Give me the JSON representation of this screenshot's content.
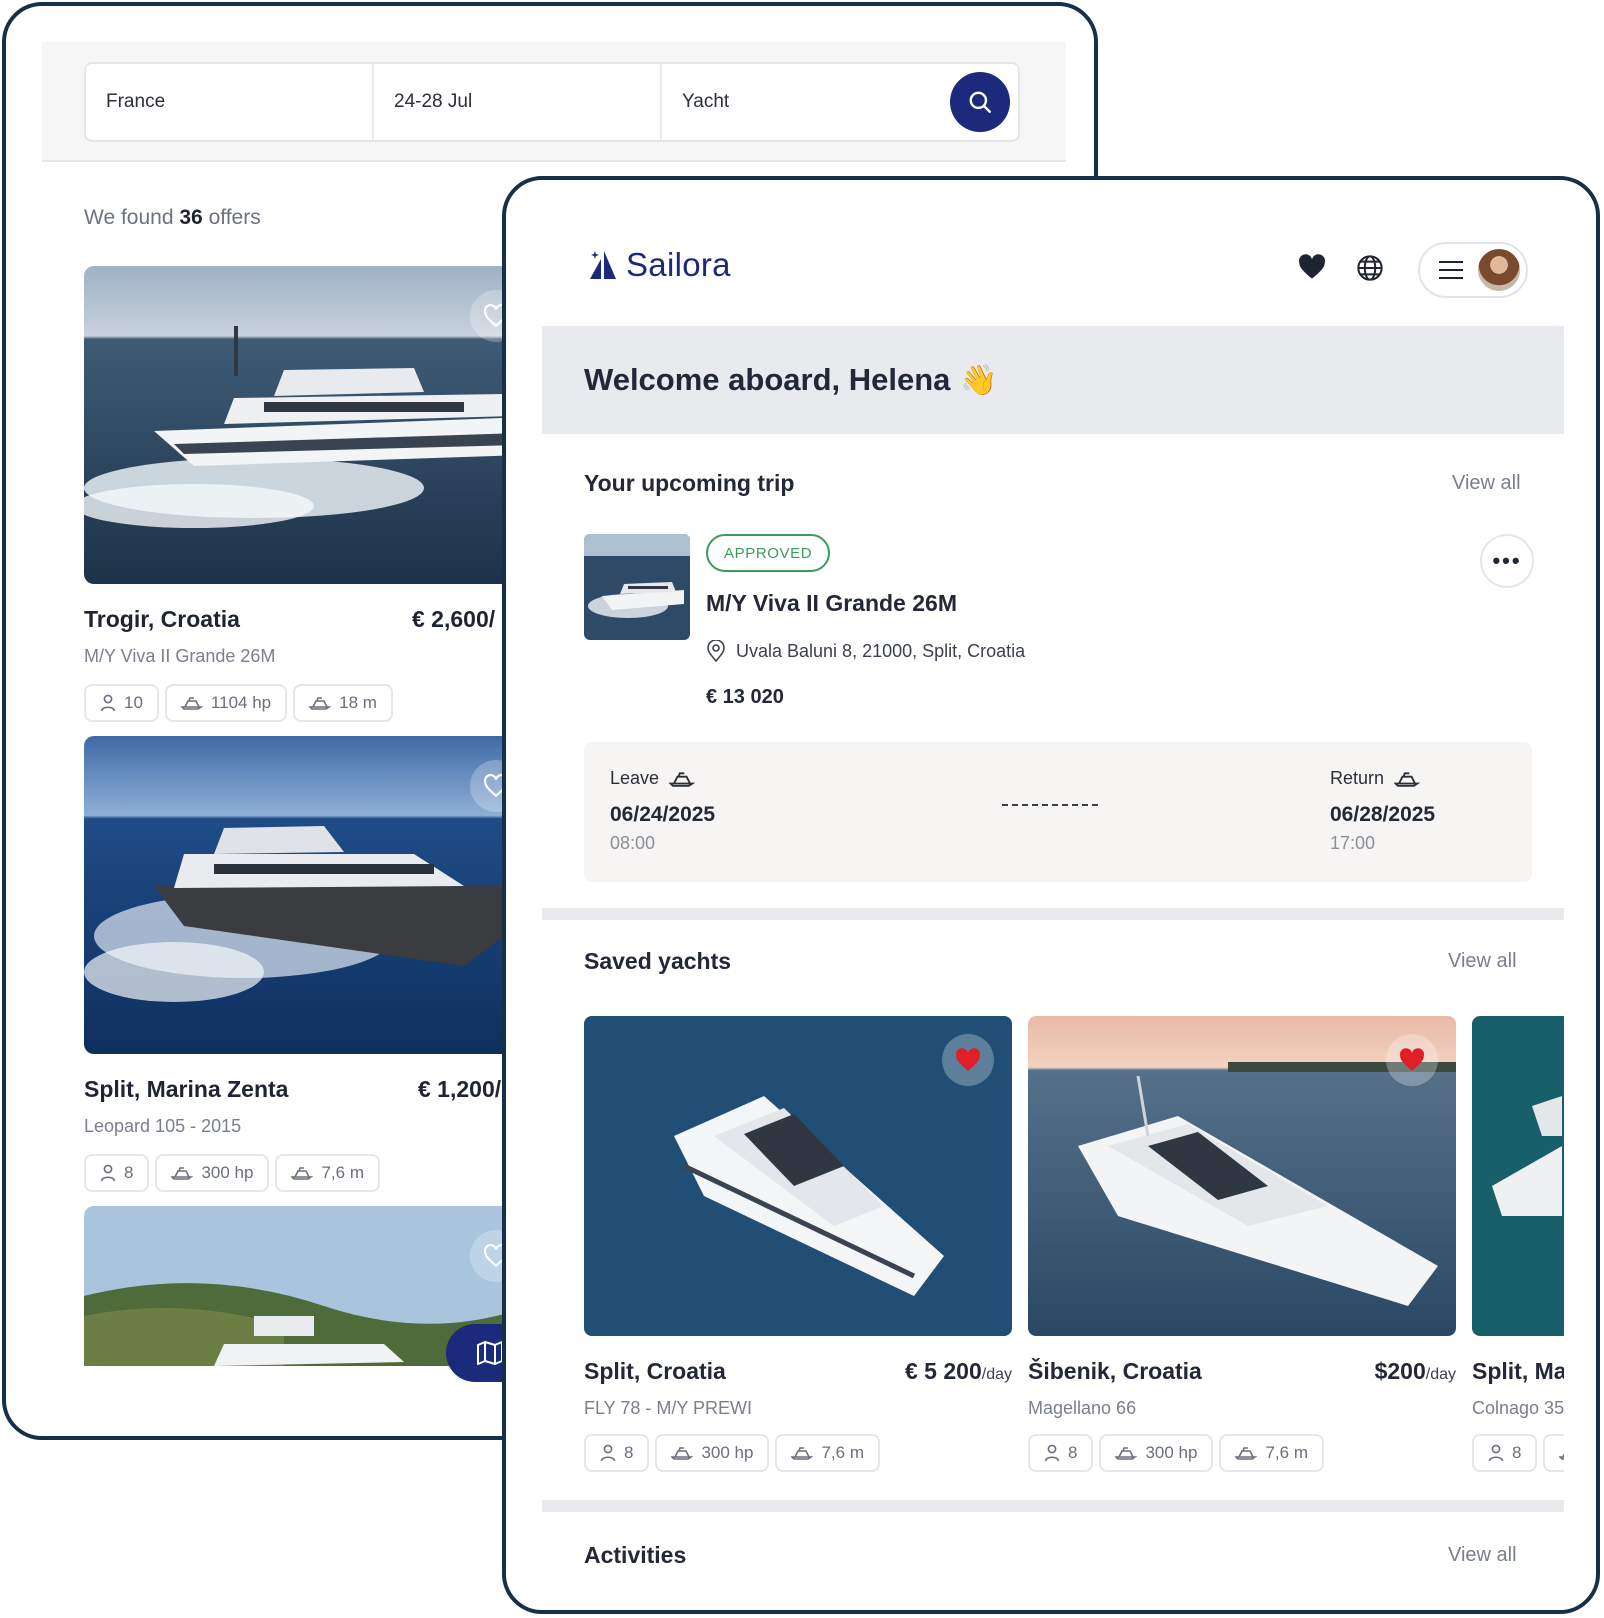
{
  "search": {
    "location": "France",
    "dates": "24-28 Jul",
    "type": "Yacht"
  },
  "results": {
    "prefix": "We found",
    "count": "36",
    "suffix": "offers"
  },
  "offers": [
    {
      "title": "Trogir, Croatia",
      "price": "€ 2,600/",
      "subtitle": "M/Y Viva II Grande 26M",
      "guests": "10",
      "power": "1104 hp",
      "length": "18 m"
    },
    {
      "title": "Split, Marina Zenta",
      "price": "€ 1,200/",
      "subtitle": "Leopard 105 - 2015",
      "guests": "8",
      "power": "300 hp",
      "length": "7,6 m"
    }
  ],
  "brand": {
    "name": "Sailora",
    "color": "#1b2a7a"
  },
  "welcome": {
    "text": "Welcome aboard, Helena",
    "emoji": "👋"
  },
  "trip": {
    "section_title": "Your upcoming trip",
    "view_all": "View all",
    "status": "APPROVED",
    "name": "M/Y Viva II Grande 26M",
    "address": "Uvala Baluni 8, 21000, Split, Croatia",
    "price": "€ 13 020",
    "leave_label": "Leave",
    "leave_date": "06/24/2025",
    "leave_time": "08:00",
    "return_label": "Return",
    "return_date": "06/28/2025",
    "return_time": "17:00",
    "more": "•••"
  },
  "saved": {
    "section_title": "Saved yachts",
    "view_all": "View all",
    "items": [
      {
        "title": "Split, Croatia",
        "price": "€ 5 200",
        "unit": "/day",
        "subtitle": "FLY 78 - M/Y PREWI",
        "guests": "8",
        "power": "300 hp",
        "length": "7,6 m"
      },
      {
        "title": "Šibenik, Croatia",
        "price": "$200",
        "unit": "/day",
        "subtitle": "Magellano 66",
        "guests": "8",
        "power": "300 hp",
        "length": "7,6 m"
      },
      {
        "title": "Split, Ma",
        "subtitle": "Colnago 35",
        "guests": "8"
      }
    ]
  },
  "activities": {
    "section_title": "Activities",
    "view_all": "View all"
  },
  "colors": {
    "accent": "#1b2a7a",
    "approved": "#3d9a5a",
    "heart_active": "#e11d2a",
    "frame": "#16304a"
  }
}
